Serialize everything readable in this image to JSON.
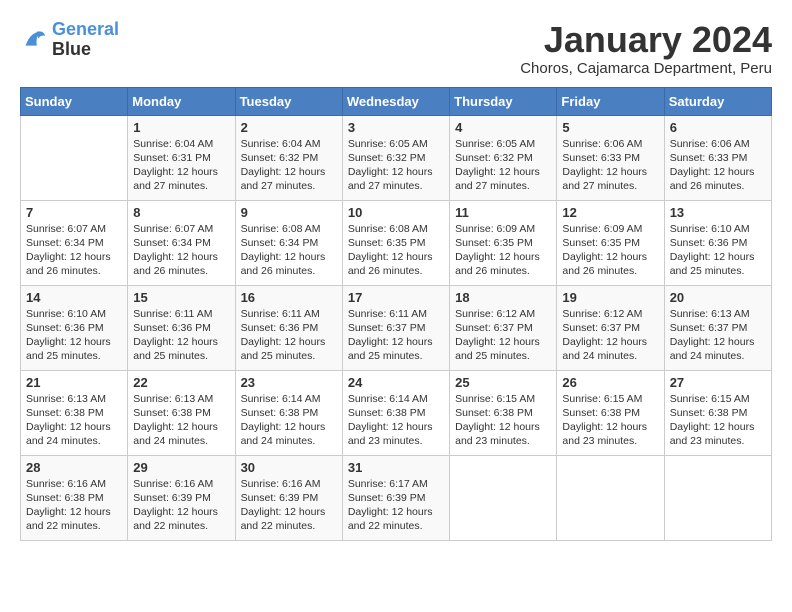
{
  "logo": {
    "line1": "General",
    "line2": "Blue"
  },
  "title": "January 2024",
  "subtitle": "Choros, Cajamarca Department, Peru",
  "days_header": [
    "Sunday",
    "Monday",
    "Tuesday",
    "Wednesday",
    "Thursday",
    "Friday",
    "Saturday"
  ],
  "weeks": [
    [
      {
        "num": "",
        "info": ""
      },
      {
        "num": "1",
        "info": "Sunrise: 6:04 AM\nSunset: 6:31 PM\nDaylight: 12 hours\nand 27 minutes."
      },
      {
        "num": "2",
        "info": "Sunrise: 6:04 AM\nSunset: 6:32 PM\nDaylight: 12 hours\nand 27 minutes."
      },
      {
        "num": "3",
        "info": "Sunrise: 6:05 AM\nSunset: 6:32 PM\nDaylight: 12 hours\nand 27 minutes."
      },
      {
        "num": "4",
        "info": "Sunrise: 6:05 AM\nSunset: 6:32 PM\nDaylight: 12 hours\nand 27 minutes."
      },
      {
        "num": "5",
        "info": "Sunrise: 6:06 AM\nSunset: 6:33 PM\nDaylight: 12 hours\nand 27 minutes."
      },
      {
        "num": "6",
        "info": "Sunrise: 6:06 AM\nSunset: 6:33 PM\nDaylight: 12 hours\nand 26 minutes."
      }
    ],
    [
      {
        "num": "7",
        "info": "Sunrise: 6:07 AM\nSunset: 6:34 PM\nDaylight: 12 hours\nand 26 minutes."
      },
      {
        "num": "8",
        "info": "Sunrise: 6:07 AM\nSunset: 6:34 PM\nDaylight: 12 hours\nand 26 minutes."
      },
      {
        "num": "9",
        "info": "Sunrise: 6:08 AM\nSunset: 6:34 PM\nDaylight: 12 hours\nand 26 minutes."
      },
      {
        "num": "10",
        "info": "Sunrise: 6:08 AM\nSunset: 6:35 PM\nDaylight: 12 hours\nand 26 minutes."
      },
      {
        "num": "11",
        "info": "Sunrise: 6:09 AM\nSunset: 6:35 PM\nDaylight: 12 hours\nand 26 minutes."
      },
      {
        "num": "12",
        "info": "Sunrise: 6:09 AM\nSunset: 6:35 PM\nDaylight: 12 hours\nand 26 minutes."
      },
      {
        "num": "13",
        "info": "Sunrise: 6:10 AM\nSunset: 6:36 PM\nDaylight: 12 hours\nand 25 minutes."
      }
    ],
    [
      {
        "num": "14",
        "info": "Sunrise: 6:10 AM\nSunset: 6:36 PM\nDaylight: 12 hours\nand 25 minutes."
      },
      {
        "num": "15",
        "info": "Sunrise: 6:11 AM\nSunset: 6:36 PM\nDaylight: 12 hours\nand 25 minutes."
      },
      {
        "num": "16",
        "info": "Sunrise: 6:11 AM\nSunset: 6:36 PM\nDaylight: 12 hours\nand 25 minutes."
      },
      {
        "num": "17",
        "info": "Sunrise: 6:11 AM\nSunset: 6:37 PM\nDaylight: 12 hours\nand 25 minutes."
      },
      {
        "num": "18",
        "info": "Sunrise: 6:12 AM\nSunset: 6:37 PM\nDaylight: 12 hours\nand 25 minutes."
      },
      {
        "num": "19",
        "info": "Sunrise: 6:12 AM\nSunset: 6:37 PM\nDaylight: 12 hours\nand 24 minutes."
      },
      {
        "num": "20",
        "info": "Sunrise: 6:13 AM\nSunset: 6:37 PM\nDaylight: 12 hours\nand 24 minutes."
      }
    ],
    [
      {
        "num": "21",
        "info": "Sunrise: 6:13 AM\nSunset: 6:38 PM\nDaylight: 12 hours\nand 24 minutes."
      },
      {
        "num": "22",
        "info": "Sunrise: 6:13 AM\nSunset: 6:38 PM\nDaylight: 12 hours\nand 24 minutes."
      },
      {
        "num": "23",
        "info": "Sunrise: 6:14 AM\nSunset: 6:38 PM\nDaylight: 12 hours\nand 24 minutes."
      },
      {
        "num": "24",
        "info": "Sunrise: 6:14 AM\nSunset: 6:38 PM\nDaylight: 12 hours\nand 23 minutes."
      },
      {
        "num": "25",
        "info": "Sunrise: 6:15 AM\nSunset: 6:38 PM\nDaylight: 12 hours\nand 23 minutes."
      },
      {
        "num": "26",
        "info": "Sunrise: 6:15 AM\nSunset: 6:38 PM\nDaylight: 12 hours\nand 23 minutes."
      },
      {
        "num": "27",
        "info": "Sunrise: 6:15 AM\nSunset: 6:38 PM\nDaylight: 12 hours\nand 23 minutes."
      }
    ],
    [
      {
        "num": "28",
        "info": "Sunrise: 6:16 AM\nSunset: 6:38 PM\nDaylight: 12 hours\nand 22 minutes."
      },
      {
        "num": "29",
        "info": "Sunrise: 6:16 AM\nSunset: 6:39 PM\nDaylight: 12 hours\nand 22 minutes."
      },
      {
        "num": "30",
        "info": "Sunrise: 6:16 AM\nSunset: 6:39 PM\nDaylight: 12 hours\nand 22 minutes."
      },
      {
        "num": "31",
        "info": "Sunrise: 6:17 AM\nSunset: 6:39 PM\nDaylight: 12 hours\nand 22 minutes."
      },
      {
        "num": "",
        "info": ""
      },
      {
        "num": "",
        "info": ""
      },
      {
        "num": "",
        "info": ""
      }
    ]
  ]
}
